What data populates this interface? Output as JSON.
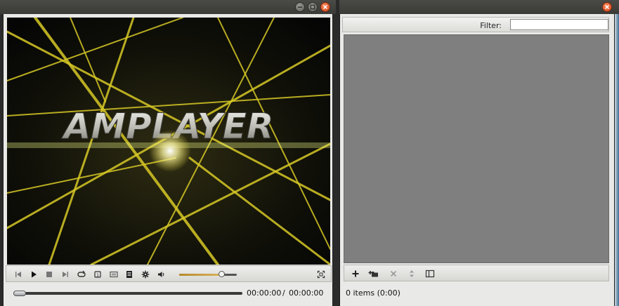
{
  "player": {
    "title_buttons": {
      "minimize_icon": "minimize-icon",
      "maximize_icon": "maximize-icon",
      "close_icon": "close-icon"
    },
    "video": {
      "logo_text": "AMPLAYER"
    },
    "controls": [
      {
        "name": "previous-button",
        "icon": "skip-back-icon"
      },
      {
        "name": "play-button",
        "icon": "play-icon"
      },
      {
        "name": "stop-button",
        "icon": "stop-icon"
      },
      {
        "name": "next-button",
        "icon": "skip-forward-icon"
      },
      {
        "name": "repeat-button",
        "icon": "repeat-icon"
      },
      {
        "name": "shuffle-button",
        "icon": "shuffle-icon"
      },
      {
        "name": "screen-button",
        "icon": "screen-icon"
      },
      {
        "name": "playlist-toggle-button",
        "icon": "playlist-icon"
      },
      {
        "name": "settings-button",
        "icon": "gear-icon"
      },
      {
        "name": "mute-button",
        "icon": "speaker-icon"
      },
      {
        "name": "fullscreen-button",
        "icon": "fullscreen-icon"
      }
    ],
    "volume_level": 0.73,
    "seek_position": 0.0,
    "time_current": "00:00:00",
    "time_separator": "/",
    "time_total": "00:00:00"
  },
  "playlist": {
    "filter": {
      "label": "Filter:",
      "value": ""
    },
    "toolbar": [
      {
        "name": "add-button",
        "icon": "plus-icon"
      },
      {
        "name": "add-folder-button",
        "icon": "folder-add-icon"
      },
      {
        "name": "remove-button",
        "icon": "x-icon"
      },
      {
        "name": "move-button",
        "icon": "updown-icon"
      },
      {
        "name": "view-button",
        "icon": "columns-icon"
      }
    ],
    "status": "0 items (0:00)"
  },
  "colors": {
    "close_button": "#d7431b",
    "titlebar": "#3f3f3c",
    "playlist_background": "#7f7f7f",
    "volume_fill": "#c9a24a"
  }
}
